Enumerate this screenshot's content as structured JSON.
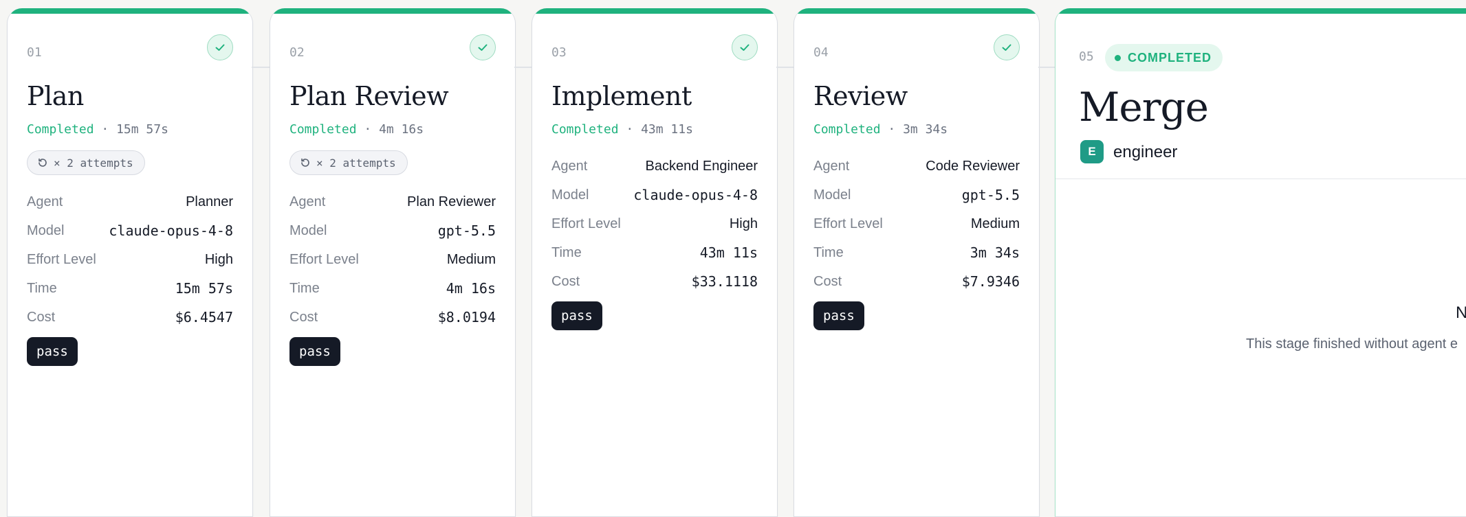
{
  "colors": {
    "accent": "#1fb27e",
    "verdict_bg": "#151a26",
    "avatar": "#1f9b86"
  },
  "labels": {
    "agent": "Agent",
    "model": "Model",
    "effort": "Effort Level",
    "time": "Time",
    "cost": "Cost"
  },
  "stages": [
    {
      "num": "01",
      "title": "Plan",
      "status": "Completed",
      "sep": "·",
      "duration": "15m 57s",
      "attempts": "× 2 attempts",
      "agent": "Planner",
      "model": "claude-opus-4-8",
      "effort": "High",
      "time": "15m 57s",
      "cost": "$6.4547",
      "verdict": "pass",
      "icon": "check-icon"
    },
    {
      "num": "02",
      "title": "Plan Review",
      "status": "Completed",
      "sep": "·",
      "duration": "4m 16s",
      "attempts": "× 2 attempts",
      "agent": "Plan Reviewer",
      "model": "gpt-5.5",
      "effort": "Medium",
      "time": "4m 16s",
      "cost": "$8.0194",
      "verdict": "pass",
      "icon": "check-icon"
    },
    {
      "num": "03",
      "title": "Implement",
      "status": "Completed",
      "sep": "·",
      "duration": "43m 11s",
      "agent": "Backend Engineer",
      "model": "claude-opus-4-8",
      "effort": "High",
      "time": "43m 11s",
      "cost": "$33.1118",
      "verdict": "pass",
      "icon": "check-icon"
    },
    {
      "num": "04",
      "title": "Review",
      "status": "Completed",
      "sep": "·",
      "duration": "3m 34s",
      "agent": "Code Reviewer",
      "model": "gpt-5.5",
      "effort": "Medium",
      "time": "3m 34s",
      "cost": "$7.9346",
      "verdict": "pass",
      "icon": "check-icon"
    }
  ],
  "merge": {
    "num": "05",
    "badge": "COMPLETED",
    "title": "Merge",
    "avatar_letter": "E",
    "role": "engineer",
    "empty_title": "N",
    "empty_desc": "This stage finished without agent e"
  }
}
